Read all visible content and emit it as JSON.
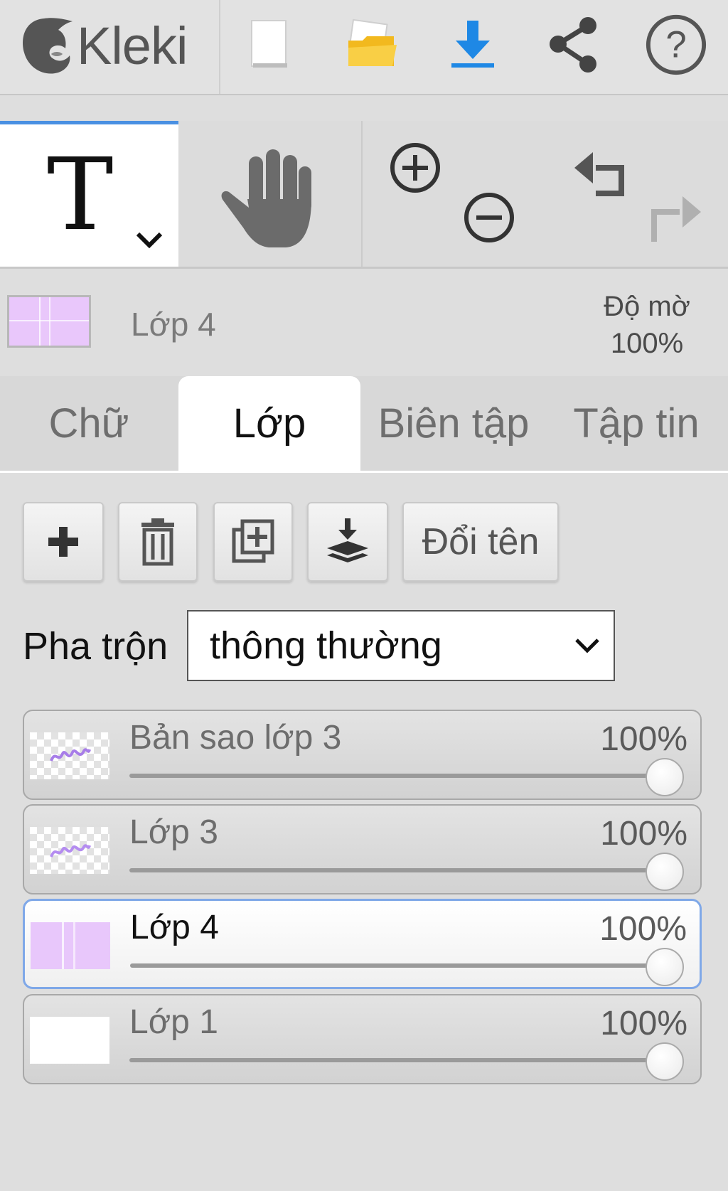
{
  "app": {
    "name": "Kleki"
  },
  "toolbar": {
    "icons": [
      "new-file-icon",
      "open-folder-icon",
      "download-icon",
      "share-icon",
      "help-icon"
    ],
    "accent_color": "#1e88e5",
    "folder_color": "#f5c518"
  },
  "tools": {
    "text_tool_glyph": "T",
    "active_tool": "text",
    "active_indicator_color": "#4a90e2"
  },
  "current_layer": {
    "name": "Lớp 4",
    "opacity_label": "Độ mờ",
    "opacity_value": "100%"
  },
  "tabs": [
    {
      "label": "Chữ",
      "active": false
    },
    {
      "label": "Lớp",
      "active": true
    },
    {
      "label": "Biên tập",
      "active": false
    },
    {
      "label": "Tập tin",
      "active": false
    }
  ],
  "layer_actions": {
    "add_icon": "plus-icon",
    "delete_icon": "trash-icon",
    "duplicate_icon": "duplicate-icon",
    "merge_icon": "merge-down-icon",
    "rename_label": "Đổi tên"
  },
  "blend": {
    "label": "Pha trộn",
    "selected": "thông thường"
  },
  "layers": [
    {
      "name": "Bản sao lớp 3",
      "opacity": "100%",
      "opacity_value": 1.0,
      "thumb": "checker-scribble",
      "selected": false
    },
    {
      "name": "Lớp 3",
      "opacity": "100%",
      "opacity_value": 1.0,
      "thumb": "checker-scribble",
      "selected": false
    },
    {
      "name": "Lớp 4",
      "opacity": "100%",
      "opacity_value": 1.0,
      "thumb": "purple",
      "selected": true
    },
    {
      "name": "Lớp 1",
      "opacity": "100%",
      "opacity_value": 1.0,
      "thumb": "white",
      "selected": false
    }
  ]
}
